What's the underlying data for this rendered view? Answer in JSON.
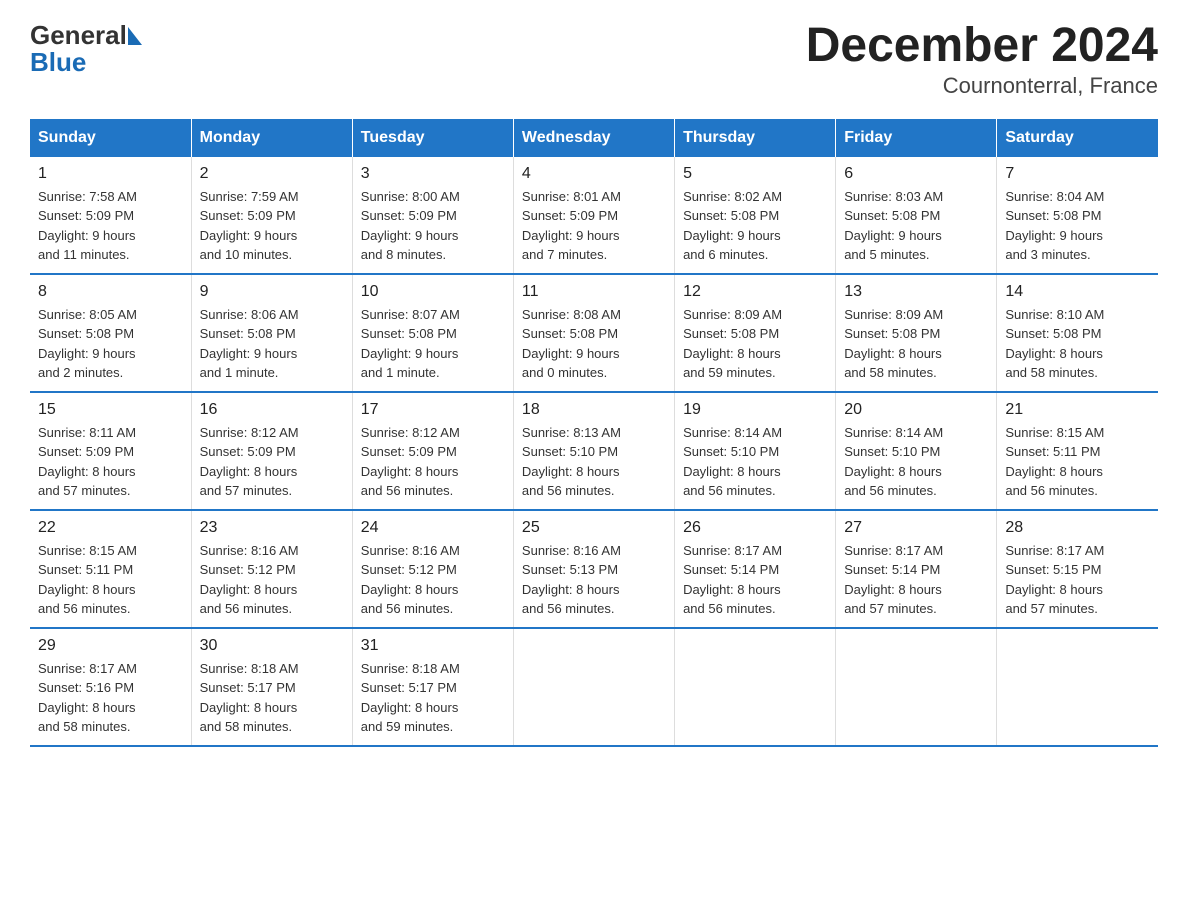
{
  "header": {
    "title": "December 2024",
    "subtitle": "Cournonterral, France",
    "logo_line1": "General",
    "logo_line2": "Blue"
  },
  "columns": [
    "Sunday",
    "Monday",
    "Tuesday",
    "Wednesday",
    "Thursday",
    "Friday",
    "Saturday"
  ],
  "weeks": [
    [
      {
        "day": "1",
        "info": "Sunrise: 7:58 AM\nSunset: 5:09 PM\nDaylight: 9 hours\nand 11 minutes."
      },
      {
        "day": "2",
        "info": "Sunrise: 7:59 AM\nSunset: 5:09 PM\nDaylight: 9 hours\nand 10 minutes."
      },
      {
        "day": "3",
        "info": "Sunrise: 8:00 AM\nSunset: 5:09 PM\nDaylight: 9 hours\nand 8 minutes."
      },
      {
        "day": "4",
        "info": "Sunrise: 8:01 AM\nSunset: 5:09 PM\nDaylight: 9 hours\nand 7 minutes."
      },
      {
        "day": "5",
        "info": "Sunrise: 8:02 AM\nSunset: 5:08 PM\nDaylight: 9 hours\nand 6 minutes."
      },
      {
        "day": "6",
        "info": "Sunrise: 8:03 AM\nSunset: 5:08 PM\nDaylight: 9 hours\nand 5 minutes."
      },
      {
        "day": "7",
        "info": "Sunrise: 8:04 AM\nSunset: 5:08 PM\nDaylight: 9 hours\nand 3 minutes."
      }
    ],
    [
      {
        "day": "8",
        "info": "Sunrise: 8:05 AM\nSunset: 5:08 PM\nDaylight: 9 hours\nand 2 minutes."
      },
      {
        "day": "9",
        "info": "Sunrise: 8:06 AM\nSunset: 5:08 PM\nDaylight: 9 hours\nand 1 minute."
      },
      {
        "day": "10",
        "info": "Sunrise: 8:07 AM\nSunset: 5:08 PM\nDaylight: 9 hours\nand 1 minute."
      },
      {
        "day": "11",
        "info": "Sunrise: 8:08 AM\nSunset: 5:08 PM\nDaylight: 9 hours\nand 0 minutes."
      },
      {
        "day": "12",
        "info": "Sunrise: 8:09 AM\nSunset: 5:08 PM\nDaylight: 8 hours\nand 59 minutes."
      },
      {
        "day": "13",
        "info": "Sunrise: 8:09 AM\nSunset: 5:08 PM\nDaylight: 8 hours\nand 58 minutes."
      },
      {
        "day": "14",
        "info": "Sunrise: 8:10 AM\nSunset: 5:08 PM\nDaylight: 8 hours\nand 58 minutes."
      }
    ],
    [
      {
        "day": "15",
        "info": "Sunrise: 8:11 AM\nSunset: 5:09 PM\nDaylight: 8 hours\nand 57 minutes."
      },
      {
        "day": "16",
        "info": "Sunrise: 8:12 AM\nSunset: 5:09 PM\nDaylight: 8 hours\nand 57 minutes."
      },
      {
        "day": "17",
        "info": "Sunrise: 8:12 AM\nSunset: 5:09 PM\nDaylight: 8 hours\nand 56 minutes."
      },
      {
        "day": "18",
        "info": "Sunrise: 8:13 AM\nSunset: 5:10 PM\nDaylight: 8 hours\nand 56 minutes."
      },
      {
        "day": "19",
        "info": "Sunrise: 8:14 AM\nSunset: 5:10 PM\nDaylight: 8 hours\nand 56 minutes."
      },
      {
        "day": "20",
        "info": "Sunrise: 8:14 AM\nSunset: 5:10 PM\nDaylight: 8 hours\nand 56 minutes."
      },
      {
        "day": "21",
        "info": "Sunrise: 8:15 AM\nSunset: 5:11 PM\nDaylight: 8 hours\nand 56 minutes."
      }
    ],
    [
      {
        "day": "22",
        "info": "Sunrise: 8:15 AM\nSunset: 5:11 PM\nDaylight: 8 hours\nand 56 minutes."
      },
      {
        "day": "23",
        "info": "Sunrise: 8:16 AM\nSunset: 5:12 PM\nDaylight: 8 hours\nand 56 minutes."
      },
      {
        "day": "24",
        "info": "Sunrise: 8:16 AM\nSunset: 5:12 PM\nDaylight: 8 hours\nand 56 minutes."
      },
      {
        "day": "25",
        "info": "Sunrise: 8:16 AM\nSunset: 5:13 PM\nDaylight: 8 hours\nand 56 minutes."
      },
      {
        "day": "26",
        "info": "Sunrise: 8:17 AM\nSunset: 5:14 PM\nDaylight: 8 hours\nand 56 minutes."
      },
      {
        "day": "27",
        "info": "Sunrise: 8:17 AM\nSunset: 5:14 PM\nDaylight: 8 hours\nand 57 minutes."
      },
      {
        "day": "28",
        "info": "Sunrise: 8:17 AM\nSunset: 5:15 PM\nDaylight: 8 hours\nand 57 minutes."
      }
    ],
    [
      {
        "day": "29",
        "info": "Sunrise: 8:17 AM\nSunset: 5:16 PM\nDaylight: 8 hours\nand 58 minutes."
      },
      {
        "day": "30",
        "info": "Sunrise: 8:18 AM\nSunset: 5:17 PM\nDaylight: 8 hours\nand 58 minutes."
      },
      {
        "day": "31",
        "info": "Sunrise: 8:18 AM\nSunset: 5:17 PM\nDaylight: 8 hours\nand 59 minutes."
      },
      {
        "day": "",
        "info": ""
      },
      {
        "day": "",
        "info": ""
      },
      {
        "day": "",
        "info": ""
      },
      {
        "day": "",
        "info": ""
      }
    ]
  ]
}
